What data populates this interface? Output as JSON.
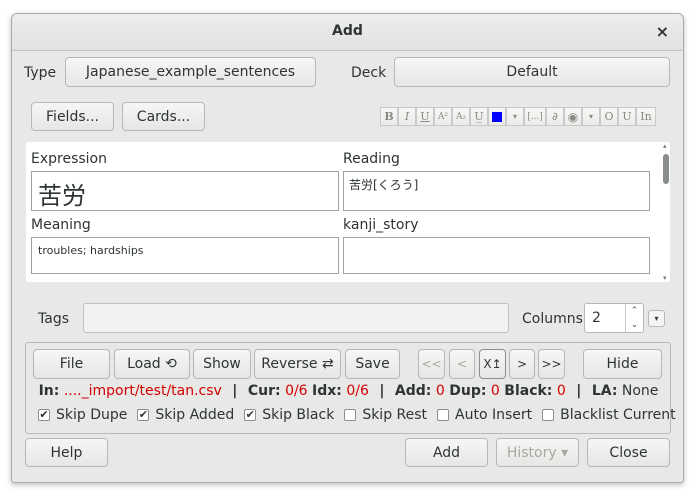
{
  "window": {
    "title": "Add",
    "close_glyph": "×"
  },
  "top_row": {
    "type_label": "Type",
    "type_value": "Japanese_example_sentences",
    "deck_label": "Deck",
    "deck_value": "Default"
  },
  "buttons": {
    "fields": "Fields...",
    "cards": "Cards..."
  },
  "format_toolbar": [
    "B",
    "I",
    "U",
    "A²",
    "A₂",
    "U̲",
    "■",
    "▾",
    "[...]",
    "📎",
    "◉",
    "▾",
    "O",
    "U",
    "In"
  ],
  "colors": {
    "text_color_swatch": "#0000ff",
    "stat_red": "#d40000"
  },
  "fields": [
    {
      "name": "Expression",
      "value": "苦労"
    },
    {
      "name": "Reading",
      "value": "苦労[くろう]"
    },
    {
      "name": "Meaning",
      "value": "troubles; hardships"
    },
    {
      "name": "kanji_story",
      "value": ""
    }
  ],
  "tags": {
    "label": "Tags",
    "value": ""
  },
  "columns": {
    "label": "Columns:",
    "value": "2",
    "up": "⌃",
    "down": "⌄",
    "dropdown": "▾"
  },
  "importer": {
    "buttons": {
      "file": "File",
      "load": "Load ⟲",
      "show": "Show",
      "reverse": "Reverse ⇄",
      "save": "Save",
      "first": "<<",
      "prev": "<",
      "jump": "X↥",
      "next": ">",
      "last": ">>",
      "hide": "Hide"
    },
    "stats": {
      "in_label": "In:",
      "in_value": "...._import/test/tan.csv",
      "cur_label": "Cur:",
      "cur_value": "0/6",
      "idx_label": "Idx:",
      "idx_value": "0/6",
      "add_label": "Add:",
      "add_value": "0",
      "dup_label": "Dup:",
      "dup_value": "0",
      "black_label": "Black:",
      "black_value": "0",
      "la_label": "LA:",
      "la_value": "None",
      "separator": "|"
    },
    "checkboxes": [
      {
        "label": "Skip Dupe",
        "checked": true
      },
      {
        "label": "Skip Added",
        "checked": true
      },
      {
        "label": "Skip Black",
        "checked": true
      },
      {
        "label": "Skip Rest",
        "checked": false
      },
      {
        "label": "Auto Insert",
        "checked": false
      },
      {
        "label": "Blacklist Current",
        "checked": false
      }
    ],
    "check_mark": "✔"
  },
  "bottom": {
    "help": "Help",
    "add": "Add",
    "history": "History ▾",
    "close": "Close"
  }
}
